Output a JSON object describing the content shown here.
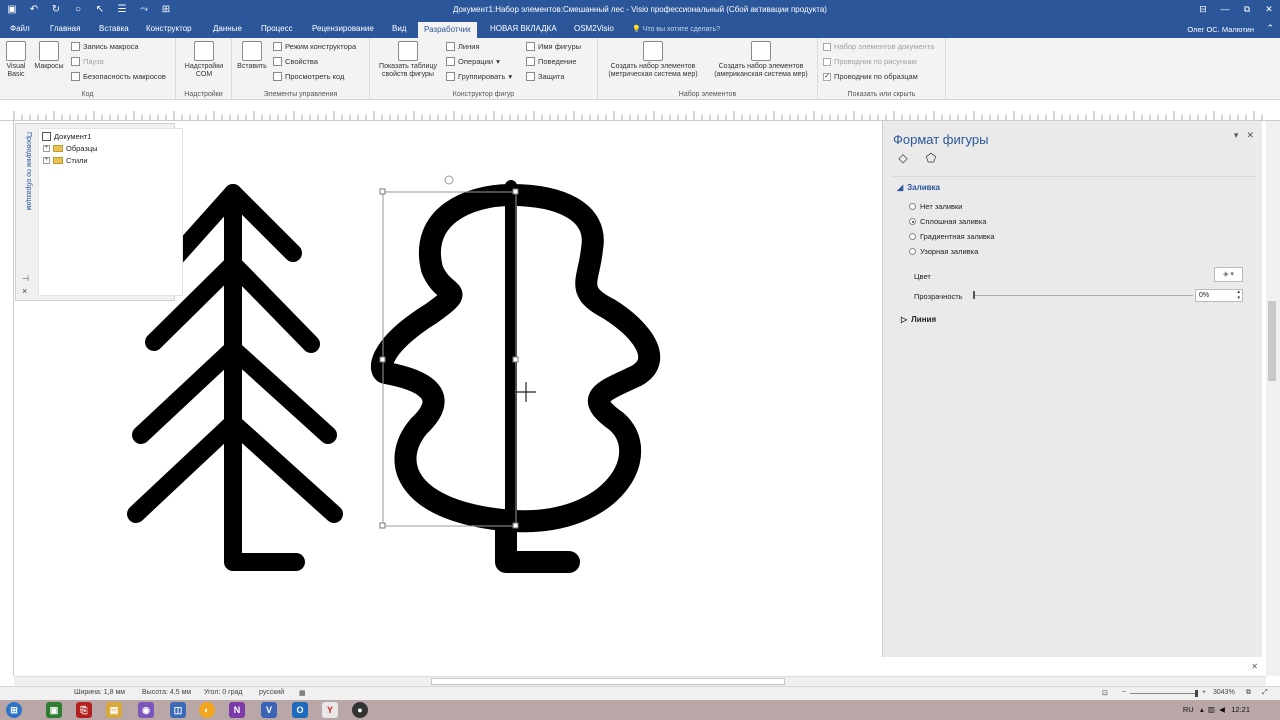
{
  "titlebar": {
    "title": "Документ1:Набор элементов:Смешанный лес - Visio профессиональный (Сбой активации продукта)",
    "minimize": "—",
    "restore": "⧉",
    "close": "✕",
    "ribbon_display": "⊟"
  },
  "tabs": [
    {
      "label": "Файл"
    },
    {
      "label": "Главная"
    },
    {
      "label": "Вставка"
    },
    {
      "label": "Конструктор"
    },
    {
      "label": "Данные"
    },
    {
      "label": "Процесс"
    },
    {
      "label": "Рецензирование"
    },
    {
      "label": "Вид"
    },
    {
      "label": "Разработчик"
    },
    {
      "label": "НОВАЯ ВКЛАДКА"
    },
    {
      "label": "OSM2Visio"
    }
  ],
  "tellme": "Что вы хотите сделать?",
  "user": "Олег ОС. Малютин",
  "ribbon": {
    "groups": {
      "code": "Код",
      "addins": "Надстройки",
      "controls": "Элементы управления",
      "shape_design": "Конструктор фигур",
      "stencil": "Набор элементов",
      "show_hide": "Показать или скрыть"
    },
    "visual_basic": "Visual Basic",
    "macros": "Макросы",
    "record_macro": "Запись макроса",
    "pause": "Пауза",
    "macro_security": "Безопасность макросов",
    "com_addins": "Надстройки COM",
    "insert": "Вставить",
    "design_mode": "Режим конструктора",
    "properties": "Свойства",
    "view_code": "Просмотреть код",
    "show_shapesheet": "Показать таблицу свойств фигуры",
    "line": "Линия",
    "operations": "Операции",
    "group": "Группировать",
    "shape_name": "Имя фигуры",
    "behavior": "Поведение",
    "protection": "Защита",
    "new_stencil_metric": "Создать набор элементов (метрическая система мер)",
    "new_stencil_us": "Создать набор элементов (американская система мер)",
    "doc_stencil": "Набор элементов документа",
    "drawing_explorer": "Проводник по рисункам",
    "master_explorer": "Проводник по образцам"
  },
  "explorer": {
    "title": "Проводник по образцам",
    "nodes": [
      "Документ1",
      "Образцы",
      "Стили"
    ],
    "expand": "+",
    "pin": "⊣",
    "close": "×"
  },
  "format_panel": {
    "title": "Формат фигуры",
    "fill_section": "Заливка",
    "fill_options": [
      "Нет заливки",
      "Сплошная заливка",
      "Градиентная заливка",
      "Узорная заливка"
    ],
    "fill_selected": 1,
    "color_label": "Цвет",
    "transparency_label": "Прозрачность",
    "transparency_value": "0%",
    "line_section": "Линия",
    "close": "✕",
    "menu": "▾",
    "tab_fill_icon": "fill-line-icon",
    "tab_shape_icon": "pentagon-icon"
  },
  "statusbar": {
    "width": "Ширина: 1,8 мм",
    "height": "Высота: 4,5 мм",
    "angle": "Угол: 0 град",
    "language": "русский",
    "lang_indicator": "RU",
    "zoom": "3043%"
  },
  "tray": {
    "time": "12:21"
  },
  "colors": {
    "accent": "#2b579a",
    "ribbon": "#f3f3f3",
    "panel": "#eaeaea",
    "taskbar": "#b9a6a6"
  }
}
